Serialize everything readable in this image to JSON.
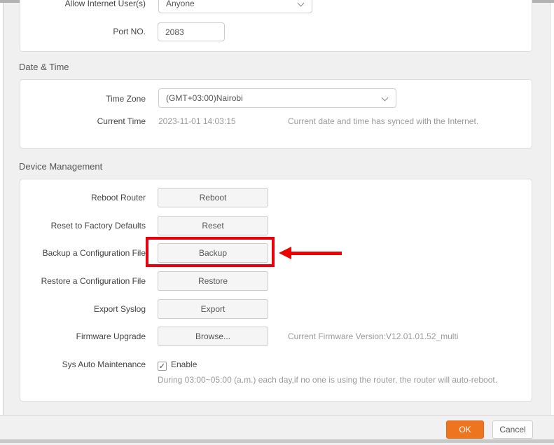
{
  "top_section": {
    "rows": [
      {
        "label": "Allow Internet User(s)",
        "value": "Anyone"
      },
      {
        "label": "Port NO.",
        "value": "2083"
      }
    ]
  },
  "date_time": {
    "title": "Date & Time",
    "time_zone_label": "Time Zone",
    "time_zone_value": "(GMT+03:00)Nairobi",
    "current_time_label": "Current Time",
    "current_time_value": "2023-11-01 14:03:15",
    "sync_note": "Current date and time has synced with the Internet."
  },
  "device_management": {
    "title": "Device Management",
    "rows": [
      {
        "label": "Reboot Router",
        "button": "Reboot"
      },
      {
        "label": "Reset to Factory Defaults",
        "button": "Reset"
      },
      {
        "label": "Backup a Configuration File",
        "button": "Backup"
      },
      {
        "label": "Restore a Configuration File",
        "button": "Restore"
      },
      {
        "label": "Export Syslog",
        "button": "Export"
      },
      {
        "label": "Firmware Upgrade",
        "button": "Browse...",
        "note": "Current Firmware Version:V12.01.01.52_multi"
      }
    ],
    "maintenance": {
      "label": "Sys Auto Maintenance",
      "checkbox_label": "Enable",
      "checked": true,
      "note": "During 03:00~05:00 (a.m.) each day,if no one is using the router, the router will auto-reboot."
    }
  },
  "footer": {
    "ok_label": "OK",
    "cancel_label": "Cancel"
  },
  "icons": {
    "check": "✓"
  },
  "colors": {
    "accent_orange": "#ee7420",
    "highlight_red": "#e8000d",
    "panel_bg": "#f0f0f0"
  }
}
